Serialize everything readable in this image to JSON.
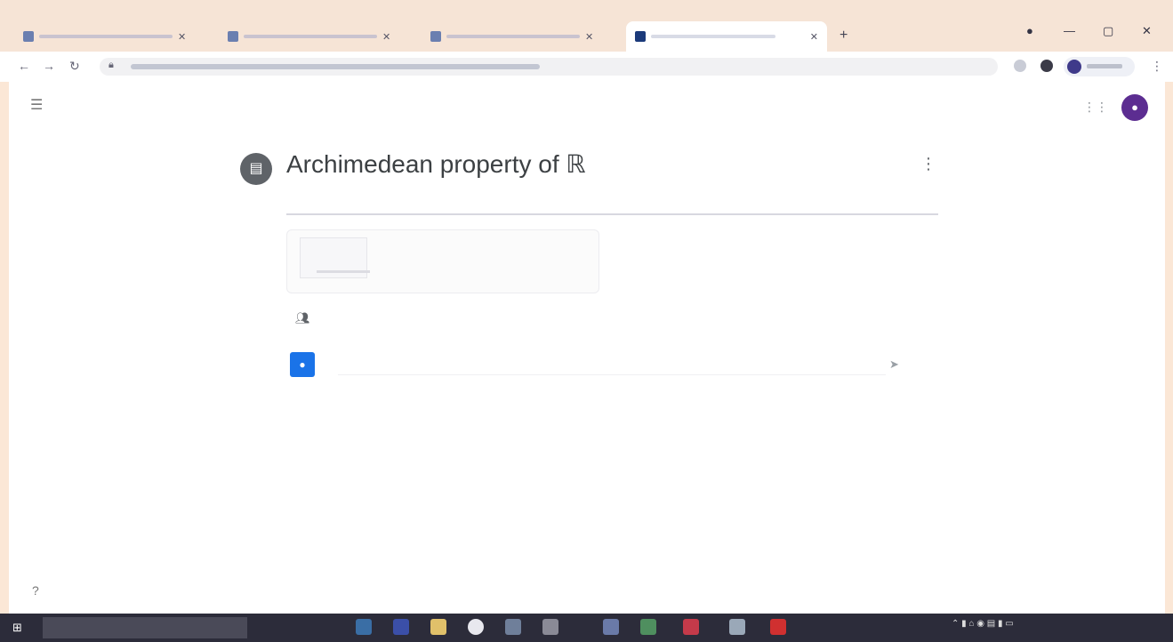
{
  "browser": {
    "tabs": [
      {
        "title": "",
        "active": false
      },
      {
        "title": "",
        "active": false
      },
      {
        "title": "",
        "active": false
      },
      {
        "title": "",
        "active": true
      }
    ],
    "new_tab_icon": "plus-icon",
    "url": ""
  },
  "classroom": {
    "class_name": "",
    "class_section": ""
  },
  "assignment": {
    "title": "Archimedean property of ℝ",
    "meta": "",
    "attachment": {
      "name": "",
      "type": ""
    },
    "comments_label": "",
    "comment_placeholder": ""
  },
  "taskbar": {
    "search_placeholder": "",
    "clock_time": "",
    "clock_date": ""
  },
  "colors": {
    "accent": "#1a73e8",
    "avatar": "#5c2d91",
    "assignment_icon": "#5f6368"
  }
}
